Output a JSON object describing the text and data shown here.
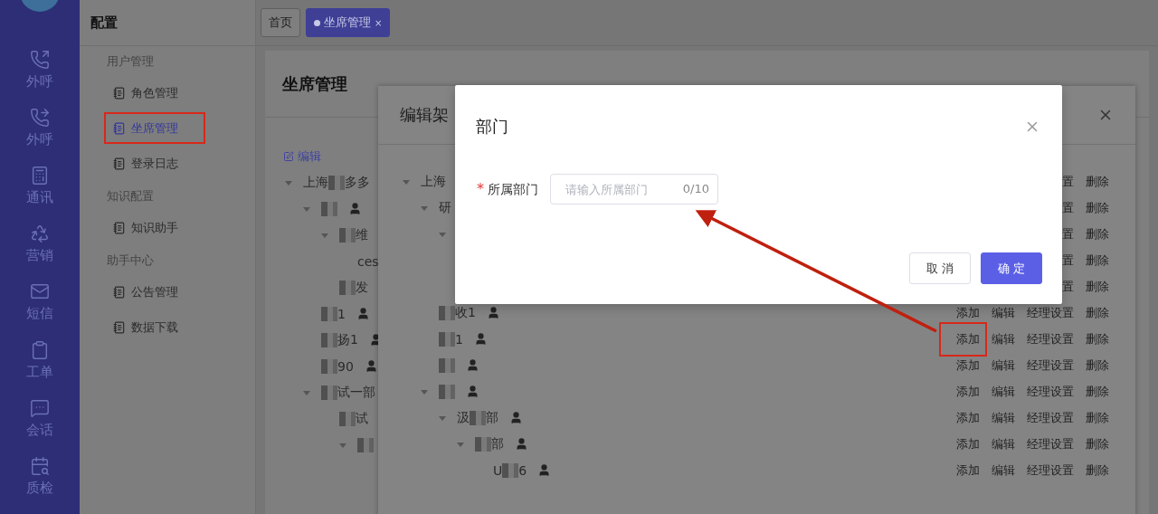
{
  "nav": [
    {
      "label": "外呼"
    },
    {
      "label": "外呼"
    },
    {
      "label": "通讯"
    },
    {
      "label": "营销"
    },
    {
      "label": "短信"
    },
    {
      "label": "工单"
    },
    {
      "label": "会话"
    },
    {
      "label": "质检"
    }
  ],
  "submenu": {
    "title": "配置",
    "groups": [
      {
        "title": "用户管理",
        "items": [
          {
            "label": "角色管理",
            "selected": false,
            "framed": false
          },
          {
            "label": "坐席管理",
            "selected": true,
            "framed": true
          },
          {
            "label": "登录日志",
            "selected": false,
            "framed": false
          }
        ]
      },
      {
        "title": "知识配置",
        "items": [
          {
            "label": "知识助手",
            "selected": false,
            "framed": false
          }
        ]
      },
      {
        "title": "助手中心",
        "items": [
          {
            "label": "公告管理",
            "selected": false,
            "framed": false
          },
          {
            "label": "数据下载",
            "selected": false,
            "framed": false
          }
        ]
      }
    ]
  },
  "tabs": [
    {
      "label": "首页",
      "selected": false
    },
    {
      "label": "坐席管理",
      "selected": true,
      "closable": true,
      "close": "×"
    }
  ],
  "page": {
    "title": "坐席管理",
    "edit_link": "编辑",
    "tree": [
      {
        "prefix": "上海",
        "redacted": true,
        "label": "多多",
        "expanded": true,
        "children": [
          {
            "redacted": true,
            "user": true,
            "expanded": true,
            "children": [
              {
                "redacted": true,
                "label": "维",
                "expanded": true,
                "children": [
                  {
                    "label": "ces"
                  }
                ]
              },
              {
                "redacted": true,
                "label": "发"
              }
            ]
          },
          {
            "redacted": true,
            "label": "1",
            "user": true
          },
          {
            "redacted": true,
            "label": "扬1",
            "user": true
          },
          {
            "redacted": true,
            "label": "90",
            "user": true
          },
          {
            "redacted": true,
            "label": "试一部",
            "expanded": true,
            "children": [
              {
                "redacted": true,
                "label": "试",
                "children": [
                  {
                    "redacted": true,
                    "expanded": true
                  }
                ]
              }
            ]
          }
        ]
      }
    ]
  },
  "drawer": {
    "title": "编辑架",
    "tree": [
      {
        "label": "上海",
        "expanded": true,
        "actions": [
          "置",
          "删除"
        ],
        "children": [
          {
            "label": "研",
            "expanded": true,
            "actions": [
              "置",
              "删除"
            ],
            "children": [
              {
                "expanded": true,
                "actions": [
                  "置",
                  "删除"
                ],
                "children": [
                  {
                    "actions": [
                      "置",
                      "删除"
                    ]
                  },
                  {
                    "actions": [
                      "置",
                      "删除"
                    ]
                  }
                ]
              }
            ]
          },
          {
            "redacted": true,
            "label": "收1",
            "user": true,
            "actions": [
              "添加",
              "编辑",
              "经理设置",
              "删除"
            ]
          },
          {
            "redacted": true,
            "label": "1",
            "user": true,
            "first_action_framed": true,
            "actions": [
              "添加",
              "编辑",
              "经理设置",
              "删除"
            ]
          },
          {
            "redacted": true,
            "user": true,
            "actions": [
              "添加",
              "编辑",
              "经理设置",
              "删除"
            ]
          },
          {
            "redacted": true,
            "user": true,
            "expanded": true,
            "actions": [
              "添加",
              "编辑",
              "经理设置",
              "删除"
            ],
            "children": [
              {
                "prefix": "汲",
                "redacted": true,
                "label": "部",
                "user": true,
                "expanded": true,
                "actions": [
                  "添加",
                  "编辑",
                  "经理设置",
                  "删除"
                ],
                "children": [
                  {
                    "redacted": true,
                    "label": "部",
                    "user": true,
                    "expanded": true,
                    "actions": [
                      "添加",
                      "编辑",
                      "经理设置",
                      "删除"
                    ],
                    "children": [
                      {
                        "prefix": "U",
                        "redacted": true,
                        "label": "6",
                        "user": true,
                        "actions": [
                          "添加",
                          "编辑",
                          "经理设置",
                          "删除"
                        ]
                      }
                    ]
                  }
                ]
              }
            ]
          }
        ]
      }
    ]
  },
  "modal": {
    "title": "部门",
    "field": {
      "label": "所属部门",
      "required_mark": "*",
      "placeholder": "请输入所属部门",
      "count": "0/10"
    },
    "buttons": [
      {
        "label": "取 消",
        "kind": "default"
      },
      {
        "label": "确 定",
        "kind": "primary"
      }
    ]
  }
}
